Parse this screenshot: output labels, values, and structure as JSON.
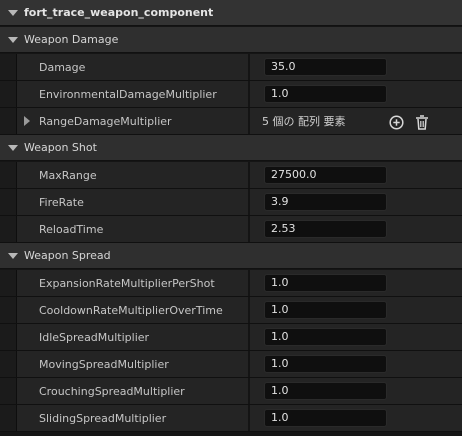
{
  "component_title": "fort_trace_weapon_component",
  "sections": {
    "damage": {
      "title": "Weapon Damage",
      "props": {
        "damage": {
          "name": "Damage",
          "value": "35.0"
        },
        "env": {
          "name": "EnvironmentalDamageMultiplier",
          "value": "1.0"
        },
        "range": {
          "name": "RangeDamageMultiplier",
          "value": "5 個の 配列 要素"
        }
      }
    },
    "shot": {
      "title": "Weapon Shot",
      "props": {
        "maxrange": {
          "name": "MaxRange",
          "value": "27500.0"
        },
        "firerate": {
          "name": "FireRate",
          "value": "3.9"
        },
        "reload": {
          "name": "ReloadTime",
          "value": "2.53"
        }
      }
    },
    "spread": {
      "title": "Weapon Spread",
      "props": {
        "expansion": {
          "name": "ExpansionRateMultiplierPerShot",
          "value": "1.0"
        },
        "cooldown": {
          "name": "CooldownRateMultiplierOverTime",
          "value": "1.0"
        },
        "idle": {
          "name": "IdleSpreadMultiplier",
          "value": "1.0"
        },
        "moving": {
          "name": "MovingSpreadMultiplier",
          "value": "1.0"
        },
        "crouching": {
          "name": "CrouchingSpreadMultiplier",
          "value": "1.0"
        },
        "sliding": {
          "name": "SlidingSpreadMultiplier",
          "value": "1.0"
        }
      }
    }
  },
  "icons": {
    "add": "add-element-icon",
    "delete": "trash-icon"
  },
  "colors": {
    "panel_bg": "#151515",
    "row_bg": "#242424",
    "header_bg": "#2f2f2f",
    "input_bg": "#0f0f0f"
  }
}
